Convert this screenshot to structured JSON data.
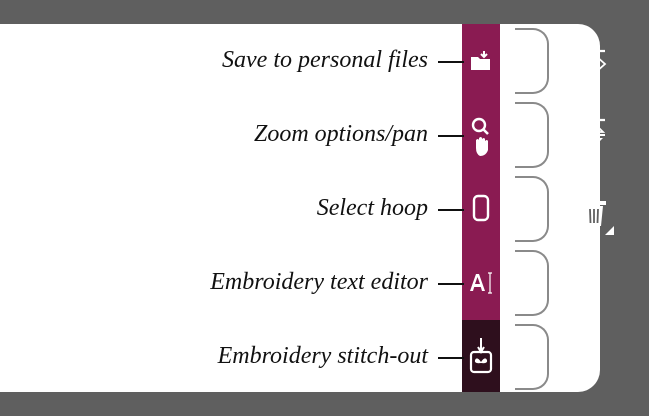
{
  "labels": {
    "save": "Save to personal files",
    "zoom": "Zoom options/pan",
    "hoop": "Select hoop",
    "text_editor": "Embroidery text editor",
    "stitchout": "Embroidery stitch-out"
  },
  "icons": {
    "save": "folder-save-icon",
    "zoom": "zoom-pan-icon",
    "hoop": "hoop-icon",
    "text_editor": "text-editor-icon",
    "stitchout": "stitch-out-icon",
    "mirror_horizontal": "mirror-side-to-side-icon",
    "mirror_vertical": "mirror-end-to-end-icon",
    "delete": "trash-icon"
  },
  "colors": {
    "strip": "#8a1b52",
    "strip_active": "#2e0f1d",
    "frame": "#5f5f5f"
  }
}
